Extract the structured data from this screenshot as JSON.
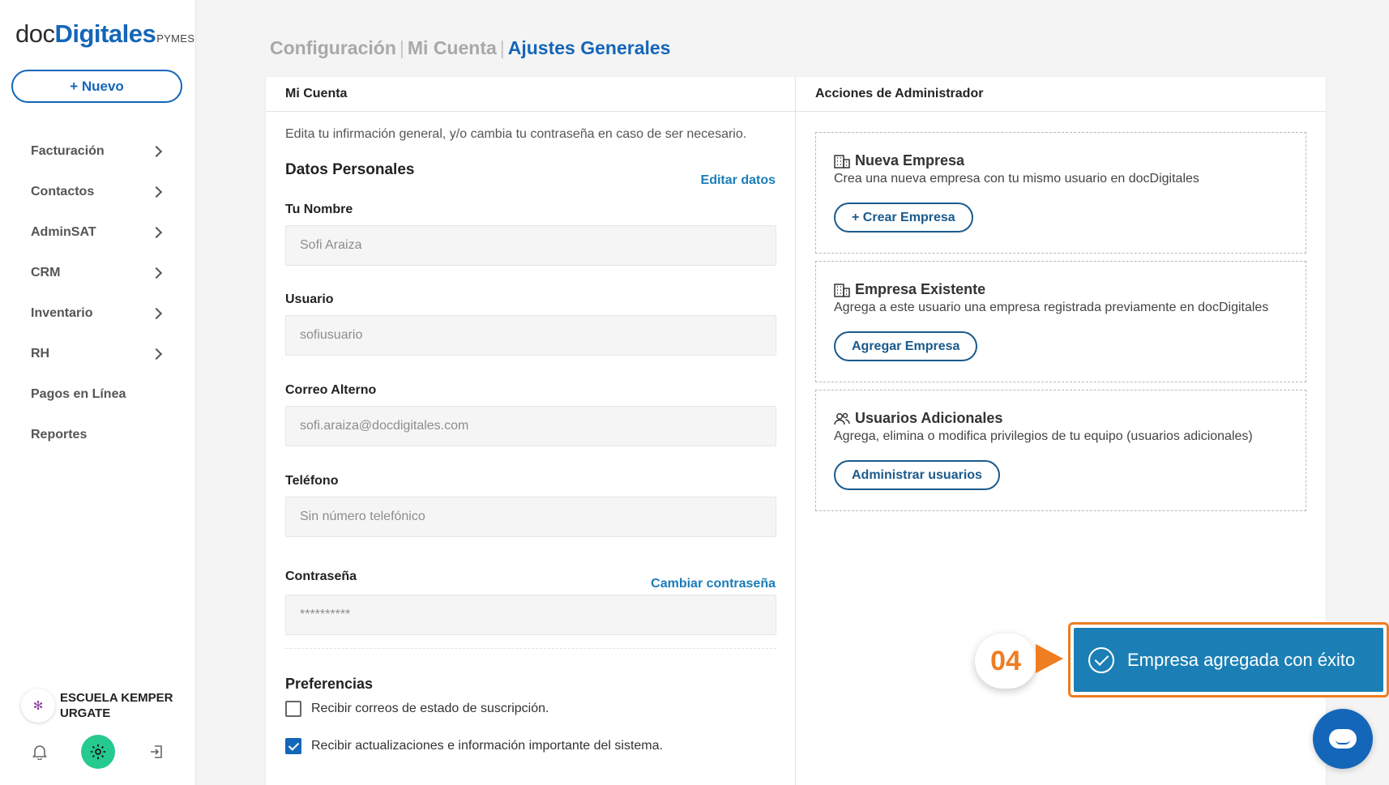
{
  "brand": {
    "part1": "doc",
    "part2": "Digitales",
    "part3": "PYMES"
  },
  "sidebar": {
    "new_button": "+ Nuevo",
    "items": [
      {
        "label": "Facturación",
        "has_children": true
      },
      {
        "label": "Contactos",
        "has_children": true
      },
      {
        "label": "AdminSAT",
        "has_children": true
      },
      {
        "label": "CRM",
        "has_children": true
      },
      {
        "label": "Inventario",
        "has_children": true
      },
      {
        "label": "RH",
        "has_children": true
      },
      {
        "label": "Pagos en Línea",
        "has_children": false
      },
      {
        "label": "Reportes",
        "has_children": false
      }
    ],
    "company_name": "ESCUELA KEMPER URGATE"
  },
  "breadcrumb": {
    "item1": "Configuración",
    "item2": "Mi Cuenta",
    "item3": "Ajustes Generales",
    "separator": "|"
  },
  "account": {
    "header": "Mi Cuenta",
    "description": "Edita tu infirmación general, y/o cambia tu contraseña en caso de ser necesario.",
    "section_title": "Datos Personales",
    "edit_link": "Editar datos",
    "fields": {
      "name": {
        "label": "Tu Nombre",
        "value": "Sofi Araiza"
      },
      "user": {
        "label": "Usuario",
        "value": "sofiusuario"
      },
      "email": {
        "label": "Correo Alterno",
        "value": "sofi.araiza@docdigitales.com"
      },
      "phone": {
        "label": "Teléfono",
        "value": "Sin número telefónico"
      },
      "password": {
        "label": "Contraseña",
        "value": "**********",
        "change_link": "Cambiar contraseña"
      }
    },
    "preferences": {
      "title": "Preferencias",
      "options": [
        {
          "label": "Recibir correos de estado de suscripción.",
          "checked": false
        },
        {
          "label": "Recibir actualizaciones e información importante del sistema.",
          "checked": true
        }
      ]
    }
  },
  "admin": {
    "header": "Acciones de Administrador",
    "boxes": [
      {
        "icon": "building-icon",
        "title": "Nueva Empresa",
        "description": "Crea una nueva empresa con tu mismo usuario en docDigitales",
        "button": "+ Crear Empresa"
      },
      {
        "icon": "building-icon",
        "title": "Empresa Existente",
        "description": "Agrega a este usuario una empresa registrada previamente en docDigitales",
        "button": "Agregar Empresa"
      },
      {
        "icon": "users-icon",
        "title": "Usuarios Adicionales",
        "description": "Agrega, elimina o modifica privilegios de tu equipo (usuarios adicionales)",
        "button": "Administrar usuarios"
      }
    ]
  },
  "toast": {
    "step": "04",
    "message": "Empresa agregada con éxito"
  },
  "colors": {
    "primary": "#1466b8",
    "accent": "#ef7d22",
    "toast": "#1b7fb5",
    "gear": "#26c98e"
  }
}
